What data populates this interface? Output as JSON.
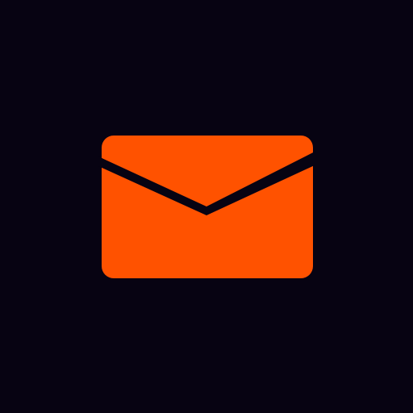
{
  "icon": {
    "name": "mail-icon",
    "body_color": "#FF5200",
    "flap_color": "#070312",
    "background_color": "#070312"
  }
}
